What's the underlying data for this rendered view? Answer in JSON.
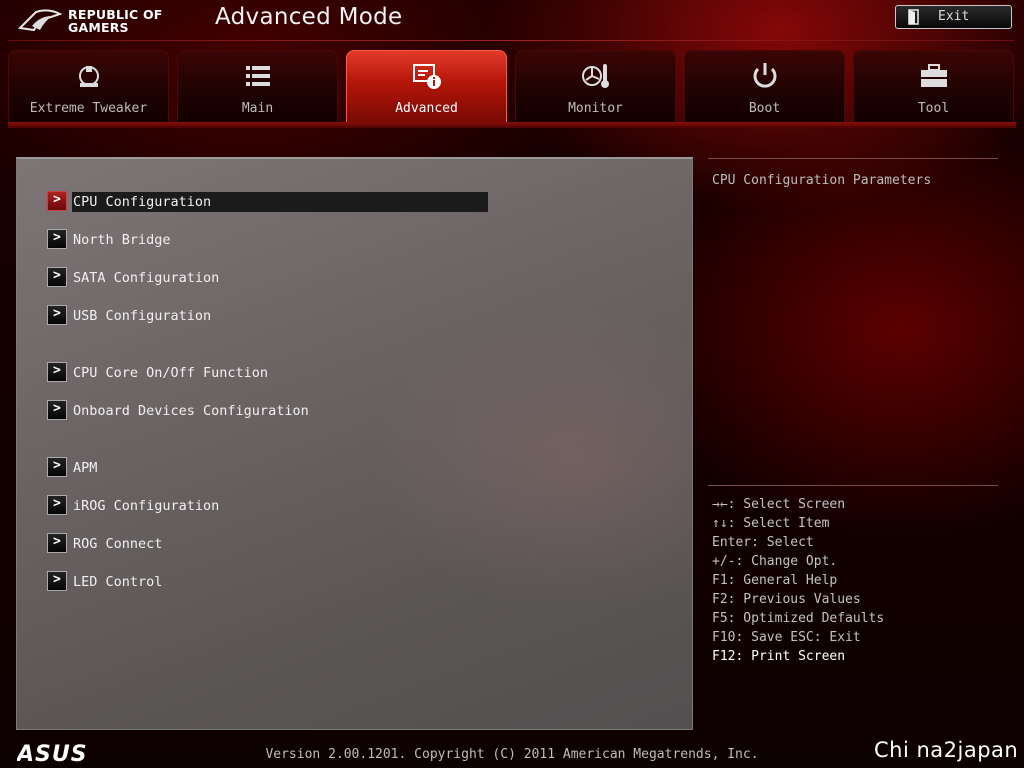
{
  "header": {
    "logo_line1": "REPUBLIC OF",
    "logo_line2": "GAMERS",
    "title": "Advanced Mode",
    "exit_label": "Exit"
  },
  "tabs": [
    {
      "label": "Extreme Tweaker",
      "icon": "extreme-tweaker-icon",
      "active": false
    },
    {
      "label": "Main",
      "icon": "list-icon",
      "active": false
    },
    {
      "label": "Advanced",
      "icon": "advanced-info-icon",
      "active": true
    },
    {
      "label": "Monitor",
      "icon": "thermometer-fan-icon",
      "active": false
    },
    {
      "label": "Boot",
      "icon": "power-icon",
      "active": false
    },
    {
      "label": "Tool",
      "icon": "toolbox-icon",
      "active": false
    }
  ],
  "menu": {
    "items": [
      {
        "label": "CPU Configuration",
        "selected": true
      },
      {
        "label": "North Bridge",
        "selected": false
      },
      {
        "label": "SATA Configuration",
        "selected": false
      },
      {
        "label": "USB Configuration",
        "selected": false
      },
      {
        "label": "CPU Core On/Off Function",
        "selected": false
      },
      {
        "label": "Onboard Devices Configuration",
        "selected": false
      },
      {
        "label": "APM",
        "selected": false
      },
      {
        "label": "iROG Configuration",
        "selected": false
      },
      {
        "label": "ROG Connect",
        "selected": false
      },
      {
        "label": "LED Control",
        "selected": false
      }
    ],
    "arrow_glyph": ">"
  },
  "help": {
    "description": "CPU Configuration Parameters",
    "keys": [
      "→←: Select Screen",
      "↑↓: Select Item",
      "Enter: Select",
      "+/-: Change Opt.",
      "F1: General Help",
      "F2: Previous Values",
      "F5: Optimized Defaults",
      "F10: Save  ESC: Exit",
      "F12: Print Screen"
    ]
  },
  "footer": {
    "brand": "ASUS",
    "version": "Version 2.00.1201. Copyright (C) 2011 American Megatrends, Inc.",
    "watermark": "Chi na2japan"
  },
  "colors": {
    "accent": "#c41a0c",
    "panel": "#6b6363",
    "selected_row": "#1b1b1b"
  }
}
